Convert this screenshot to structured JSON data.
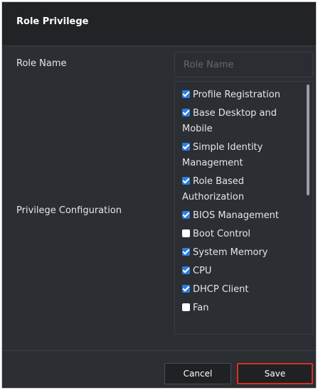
{
  "dialog": {
    "title": "Role Privilege"
  },
  "role_name": {
    "label": "Role Name",
    "value": "",
    "placeholder": "Role Name"
  },
  "privileges": {
    "label": "Privilege Configuration",
    "items": [
      {
        "label": "Profile Registration",
        "checked": true
      },
      {
        "label": "Base Desktop and Mobile",
        "checked": true
      },
      {
        "label": "Simple Identity Management",
        "checked": true
      },
      {
        "label": "Role Based Authorization",
        "checked": true
      },
      {
        "label": "BIOS Management",
        "checked": true
      },
      {
        "label": "Boot Control",
        "checked": false
      },
      {
        "label": "System Memory",
        "checked": true
      },
      {
        "label": "CPU",
        "checked": true
      },
      {
        "label": "DHCP Client",
        "checked": true
      },
      {
        "label": "Fan",
        "checked": false
      }
    ]
  },
  "footer": {
    "cancel_label": "Cancel",
    "save_label": "Save"
  },
  "colors": {
    "background": "#2b2e33",
    "header_background": "#212327",
    "checkbox_checked": "#2f7de1",
    "save_highlight": "#d9301f"
  }
}
